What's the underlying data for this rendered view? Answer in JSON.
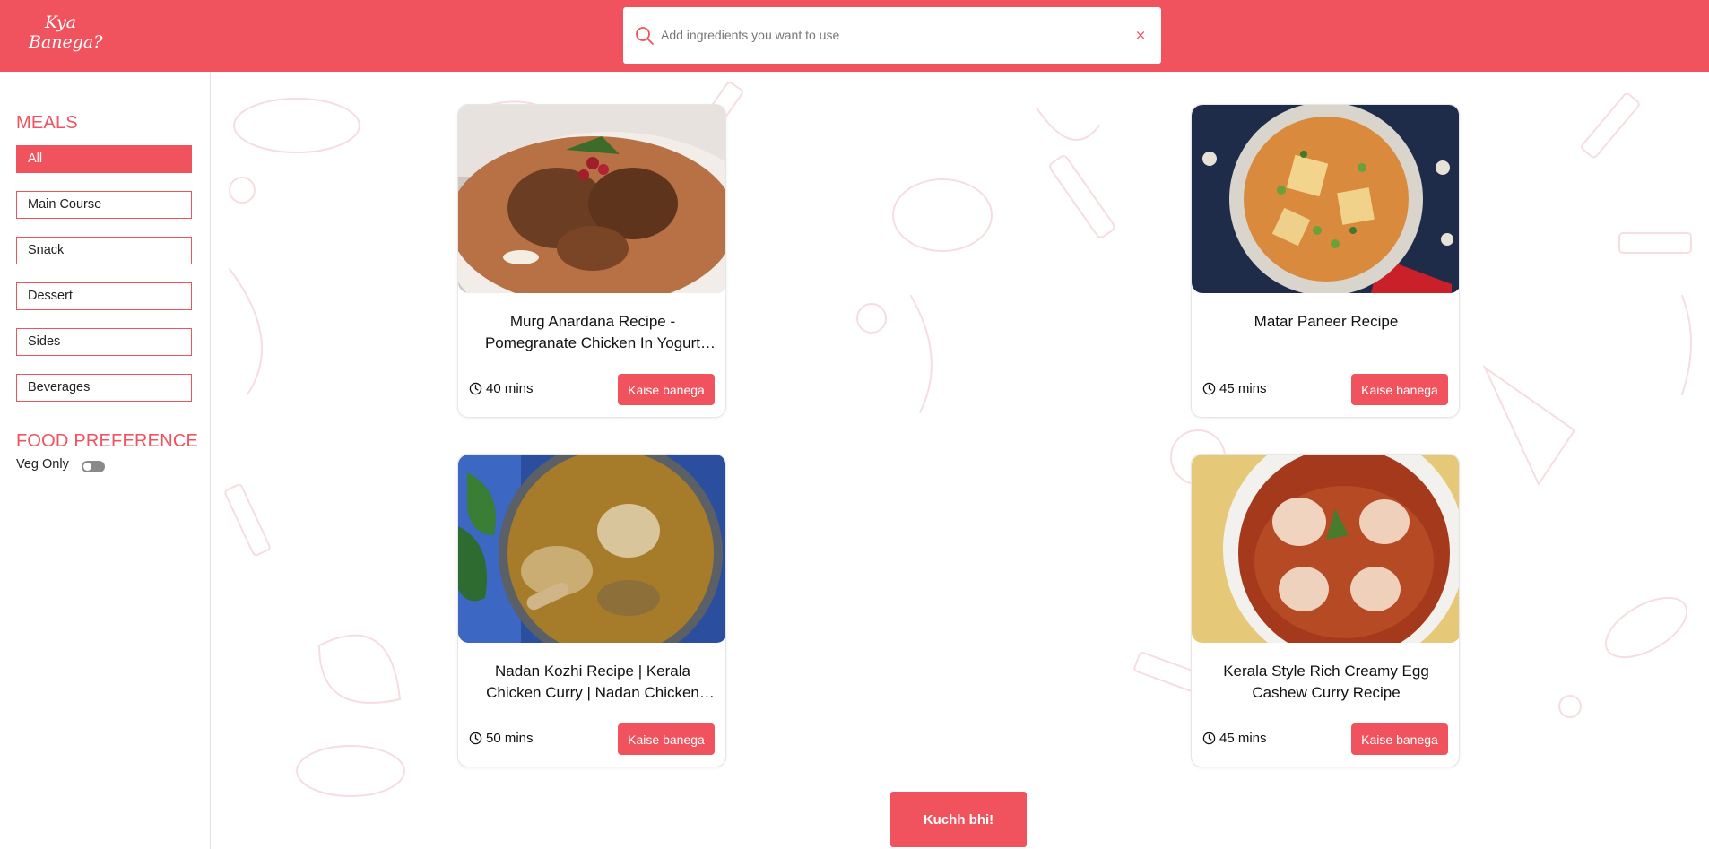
{
  "header": {
    "logo_line1": "Kya",
    "logo_line2": "Banega?",
    "search_placeholder": "Add ingredients you want to use",
    "search_value": "",
    "clear_label": "×",
    "accent_color": "#f0525e"
  },
  "sidebar": {
    "meals_title": "MEALS",
    "meals": [
      {
        "label": "All",
        "active": true
      },
      {
        "label": "Main Course",
        "active": false
      },
      {
        "label": "Snack",
        "active": false
      },
      {
        "label": "Dessert",
        "active": false
      },
      {
        "label": "Sides",
        "active": false
      },
      {
        "label": "Beverages",
        "active": false
      }
    ],
    "preference_title": "FOOD PREFERENCE",
    "veg_only_label": "Veg Only",
    "veg_only_on": false
  },
  "recipes": [
    {
      "title": "Murg Anardana Recipe - Pomegranate Chicken In Yogurt Gravy",
      "time": "40 mins",
      "button": "Kaise banega",
      "image_icon": "chicken-curry-photo"
    },
    {
      "title": "Matar Paneer Recipe",
      "time": "45 mins",
      "button": "Kaise banega",
      "image_icon": "paneer-curry-photo"
    },
    {
      "title": "Nadan Kozhi Recipe | Kerala Chicken Curry | Nadan Chicken Curry",
      "time": "50 mins",
      "button": "Kaise banega",
      "image_icon": "kerala-chicken-photo"
    },
    {
      "title": "Kerala Style Rich Creamy Egg Cashew Curry Recipe",
      "time": "45 mins",
      "button": "Kaise banega",
      "image_icon": "egg-curry-photo"
    }
  ],
  "random_button": "Kuchh bhi!"
}
